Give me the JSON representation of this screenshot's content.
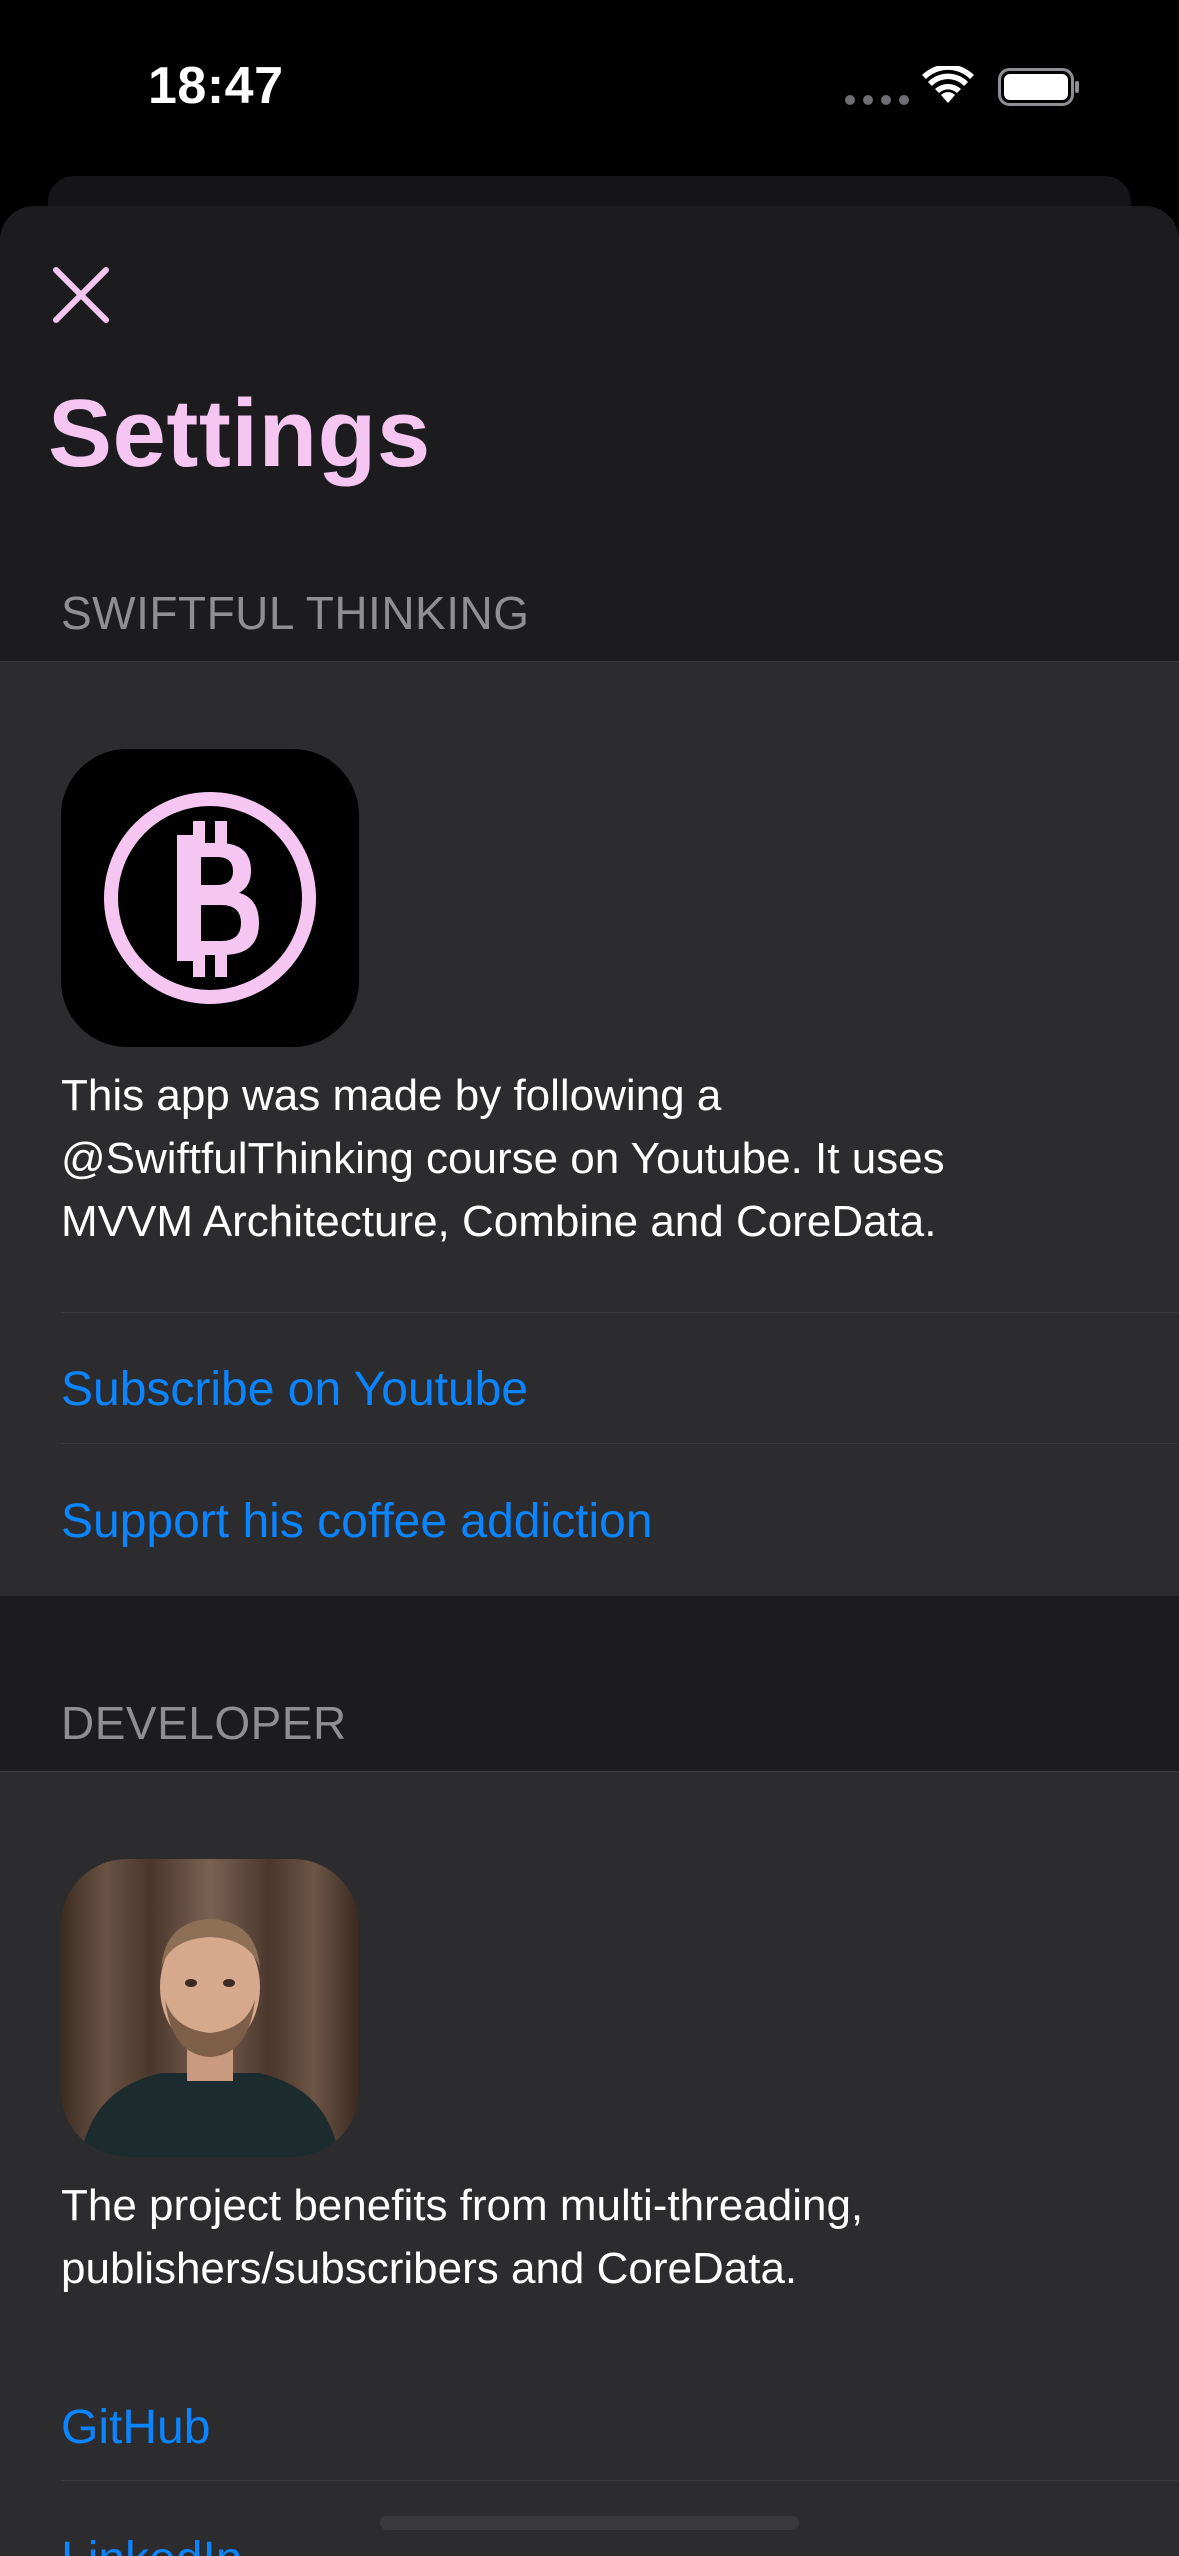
{
  "status_bar": {
    "time": "18:47"
  },
  "header": {
    "close_icon": "close-icon",
    "title": "Settings"
  },
  "sections": {
    "swiftful": {
      "header": "SWIFTFUL THINKING",
      "icon": "bitcoin-icon",
      "description_lines": [
        "This app was made by following a",
        "@SwiftfulThinking course on Youtube. It uses",
        "MVVM Architecture, Combine and CoreData."
      ],
      "links": [
        "Subscribe on Youtube",
        "Support his coffee addiction"
      ]
    },
    "developer": {
      "header": "DEVELOPER",
      "avatar": "developer-avatar",
      "description_lines": [
        "The project benefits from multi-threading,",
        "publishers/subscribers and CoreData."
      ],
      "links": [
        "GitHub",
        "LinkedIn"
      ]
    }
  },
  "colors": {
    "accent_pink": "#f5c6f2",
    "link_blue": "#0a84ff",
    "sheet_background": "#1c1c1e",
    "card_background": "#2c2c2e",
    "section_header": "#8e8e93"
  }
}
